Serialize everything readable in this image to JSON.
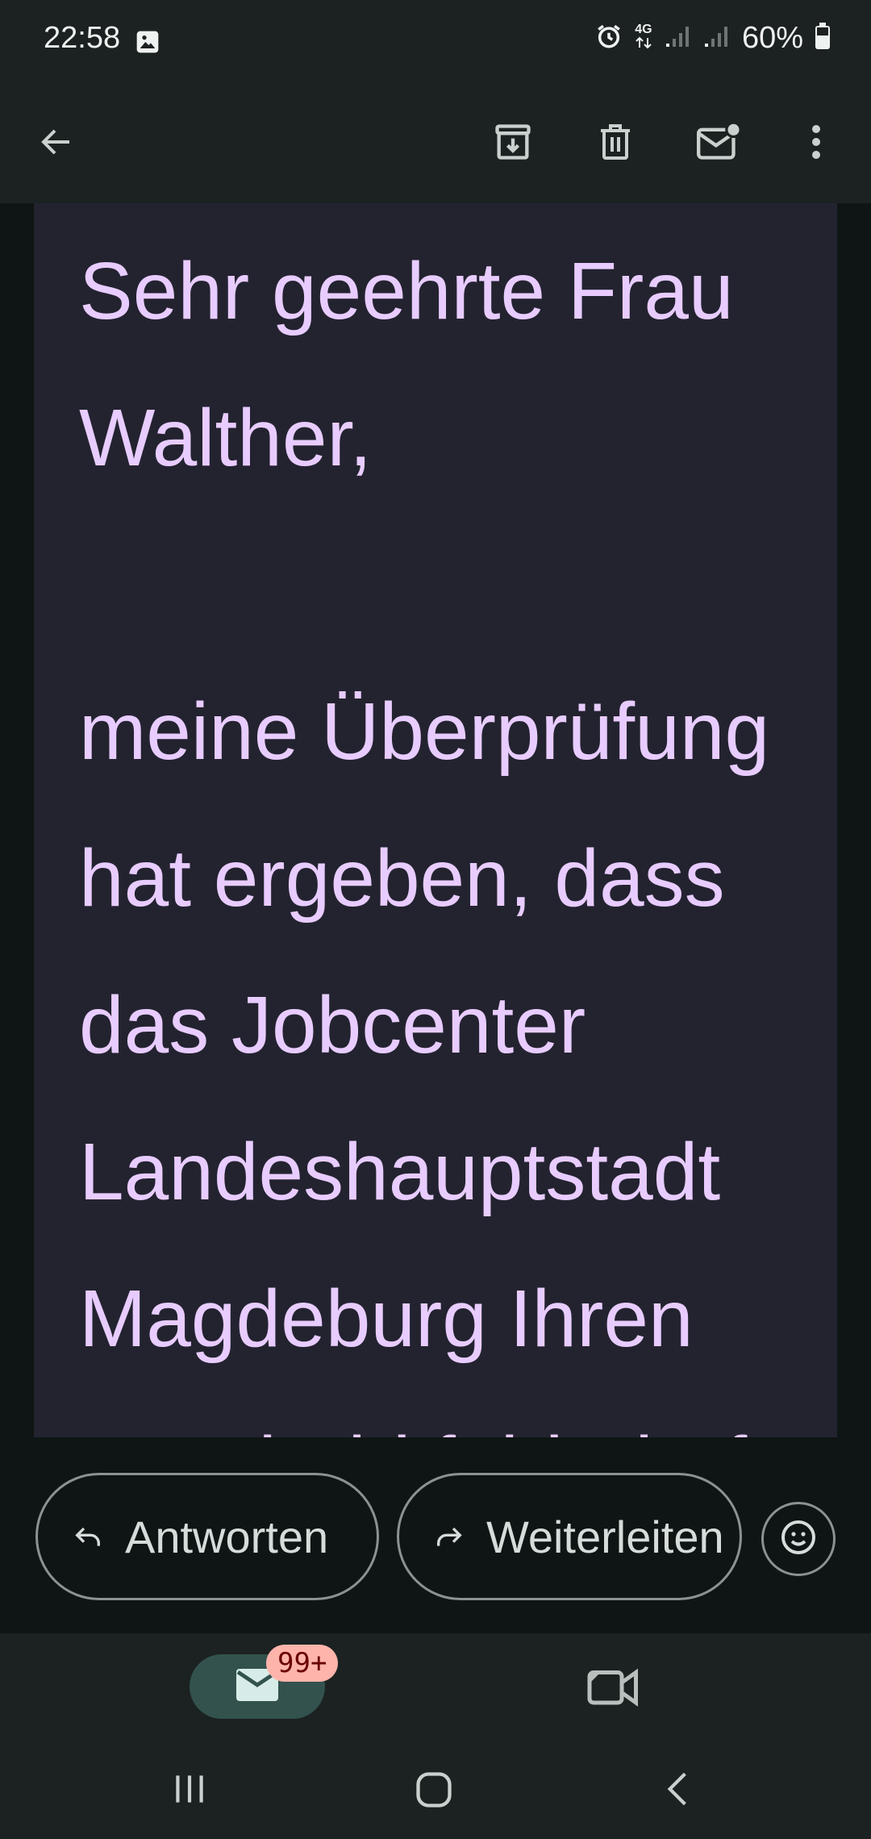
{
  "status_bar": {
    "time": "22:58",
    "network": "4G",
    "battery": "60%",
    "icons": [
      "image-icon",
      "alarm-icon",
      "network-icon",
      "signal-icon",
      "signal-icon",
      "battery-icon"
    ]
  },
  "toolbar": {
    "icons": [
      "back-arrow-icon",
      "archive-icon",
      "delete-icon",
      "mark-unread-icon",
      "more-vert-icon"
    ]
  },
  "message": {
    "body": "Sehr geehrte Frau Walther,\n\nmeine Überprüfung hat ergeben, dass das Jobcenter Landeshauptstadt Magdeburg Ihren Bescheid fehlerhaft"
  },
  "actions": {
    "reply_label": "Antworten",
    "forward_label": "Weiterleiten",
    "icons": [
      "reply-icon",
      "forward-icon",
      "emoji-icon"
    ]
  },
  "bottom_nav": {
    "mail_badge": "99+",
    "icons": [
      "mail-icon",
      "meet-video-icon"
    ]
  },
  "system_nav": {
    "icons": [
      "recents-icon",
      "home-icon",
      "back-icon"
    ]
  },
  "colors": {
    "text_accent": "#e8ccff",
    "card_background": "#232330",
    "app_background": "#0e1514",
    "badge_background": "#ffb4ab"
  }
}
